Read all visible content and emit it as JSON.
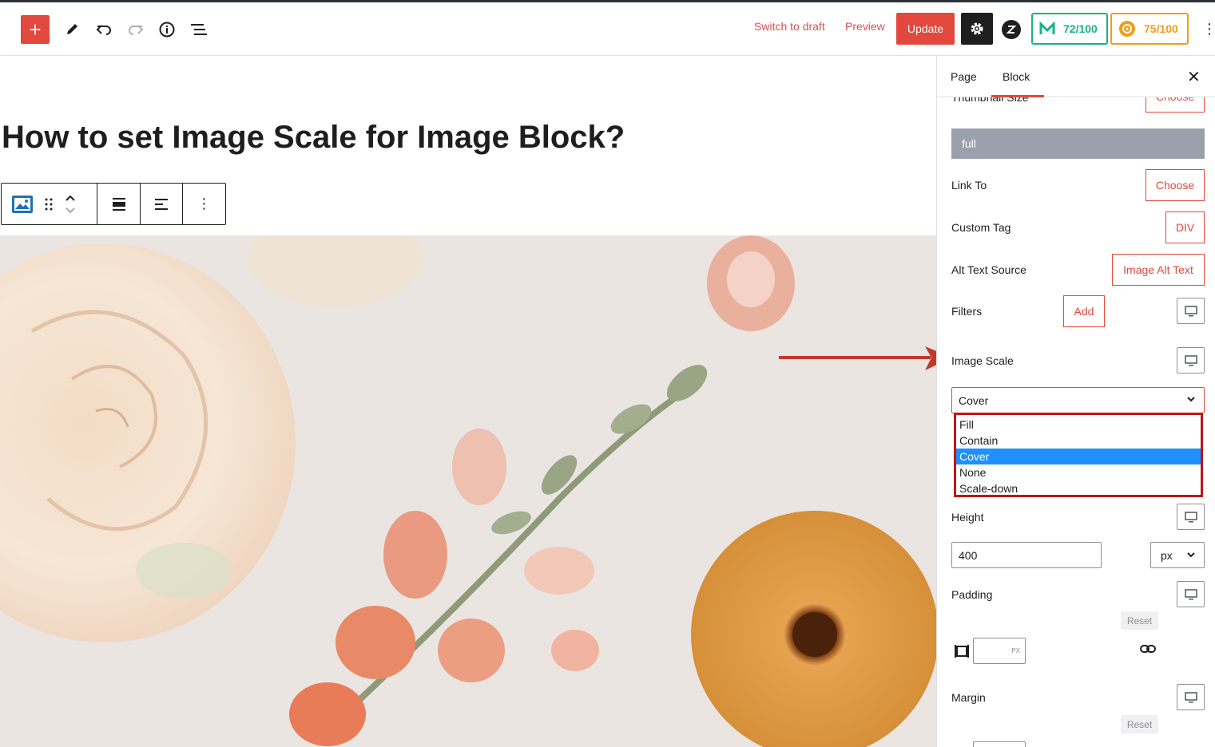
{
  "toolbar": {
    "switch_to_draft": "Switch to draft",
    "preview": "Preview",
    "update": "Update",
    "score_seo": "72/100",
    "score_readability": "75/100",
    "icons": [
      "plus-icon",
      "pencil-icon",
      "undo-icon",
      "redo-icon",
      "info-icon",
      "list-view-icon",
      "gear-icon",
      "kebab-icon"
    ]
  },
  "editor": {
    "post_title": "How to set Image Scale for Image Block?"
  },
  "sidebar": {
    "tabs": {
      "page": "Page",
      "block": "Block"
    },
    "thumbnail_size": {
      "label": "Thumbnail Size",
      "button": "Choose",
      "value": "full"
    },
    "link_to": {
      "label": "Link To",
      "button": "Choose"
    },
    "custom_tag": {
      "label": "Custom Tag",
      "button": "DIV"
    },
    "alt_text_source": {
      "label": "Alt Text Source",
      "button": "Image Alt Text"
    },
    "filters": {
      "label": "Filters",
      "button": "Add"
    },
    "image_scale": {
      "label": "Image Scale",
      "selected": "Cover",
      "options": [
        "Fill",
        "Contain",
        "Cover",
        "None",
        "Scale-down"
      ]
    },
    "height": {
      "label": "Height",
      "value": "400",
      "unit": "px"
    },
    "padding": {
      "label": "Padding",
      "reset": "Reset",
      "unit": "PX"
    },
    "margin": {
      "label": "Margin",
      "reset": "Reset"
    }
  },
  "colors": {
    "accent": "#e2483d",
    "dropdown_highlight": "#1e90ff",
    "dropdown_border": "#c0151b",
    "arrow": "#c0392b"
  }
}
